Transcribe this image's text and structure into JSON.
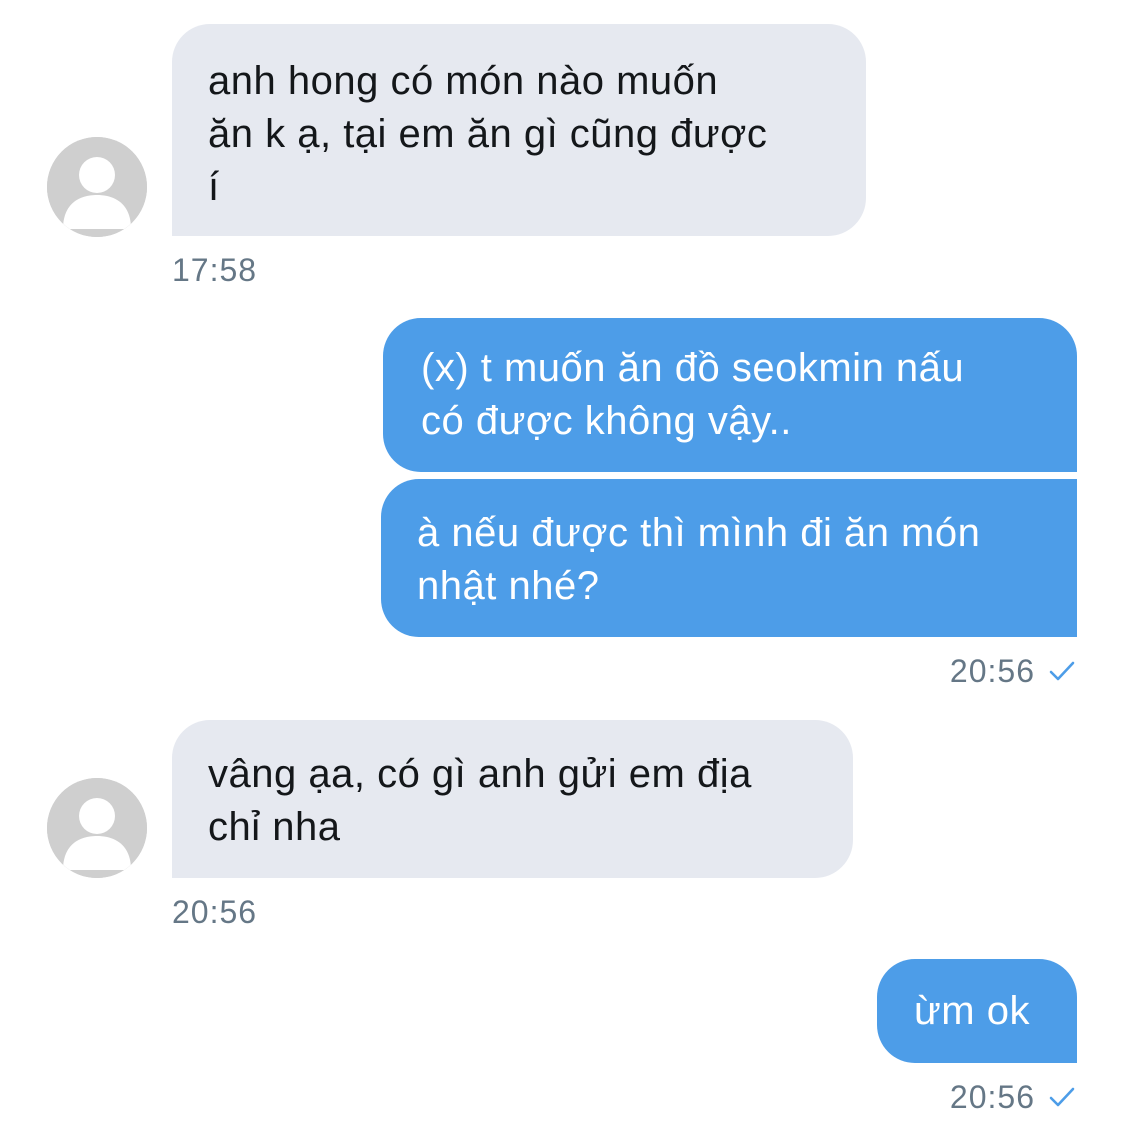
{
  "messages": [
    {
      "direction": "incoming",
      "text": "anh hong có món nào muốn\năn k ạ, tại em ăn gì cũng được\ní"
    },
    {
      "direction": "incoming_time",
      "text": "17:58"
    },
    {
      "direction": "outgoing",
      "text": "(x) t muốn ăn đồ seokmin nấu\ncó được không vậy.."
    },
    {
      "direction": "outgoing",
      "text": "à nếu được thì mình đi ăn món\nnhật nhé?"
    },
    {
      "direction": "outgoing_time",
      "text": "20:56"
    },
    {
      "direction": "incoming",
      "text": "vâng ạa, có gì anh gửi em địa\nchỉ nha"
    },
    {
      "direction": "incoming_time",
      "text": "20:56"
    },
    {
      "direction": "outgoing",
      "text": "ừm ok"
    },
    {
      "direction": "outgoing_time",
      "text": "20:56"
    }
  ],
  "icons": {
    "avatar": "default-user-avatar-icon",
    "read_receipt": "checkmark-icon"
  },
  "colors": {
    "incoming_bubble": "#e6e9f0",
    "outgoing_bubble": "#4d9de8",
    "timestamp": "#657786",
    "checkmark": "#4d9de8"
  }
}
